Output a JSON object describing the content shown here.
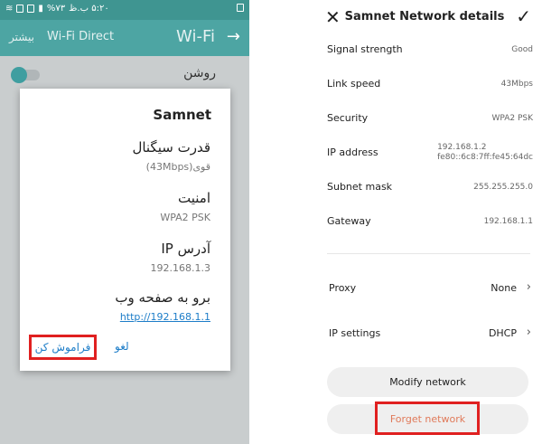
{
  "left": {
    "status": {
      "time": "۵:۲۰ ب.ظ",
      "battery": "٧٣%"
    },
    "appbar": {
      "more": "بیشتر",
      "wifi_direct": "Wi-Fi Direct",
      "wifi": "Wi-Fi"
    },
    "toggle_label": "روشن",
    "dialog": {
      "title": "Samnet",
      "signal_label": "قدرت سیگنال",
      "signal_value": "قوی(43Mbps)",
      "security_label": "امنیت",
      "security_value": "WPA2 PSK",
      "ip_label": "آدرس IP",
      "ip_value": "192.168.1.3",
      "web_label": "برو به صفحه وب",
      "web_link": "http://192.168.1.1",
      "cancel": "لغو",
      "forget": "فراموش کن"
    }
  },
  "right": {
    "title": "Samnet Network details",
    "rows": [
      {
        "label": "Signal strength",
        "value": "Good"
      },
      {
        "label": "Link speed",
        "value": "43Mbps"
      },
      {
        "label": "Security",
        "value": "WPA2 PSK"
      },
      {
        "label": "IP address",
        "value": "192.168.1.2",
        "value2": "fe80::6c8:7ff:fe45:64dc"
      },
      {
        "label": "Subnet mask",
        "value": "255.255.255.0"
      },
      {
        "label": "Gateway",
        "value": "192.168.1.1"
      }
    ],
    "proxy": {
      "label": "Proxy",
      "value": "None"
    },
    "ip_settings": {
      "label": "IP settings",
      "value": "DHCP"
    },
    "modify": "Modify network",
    "forget": "Forget network"
  }
}
